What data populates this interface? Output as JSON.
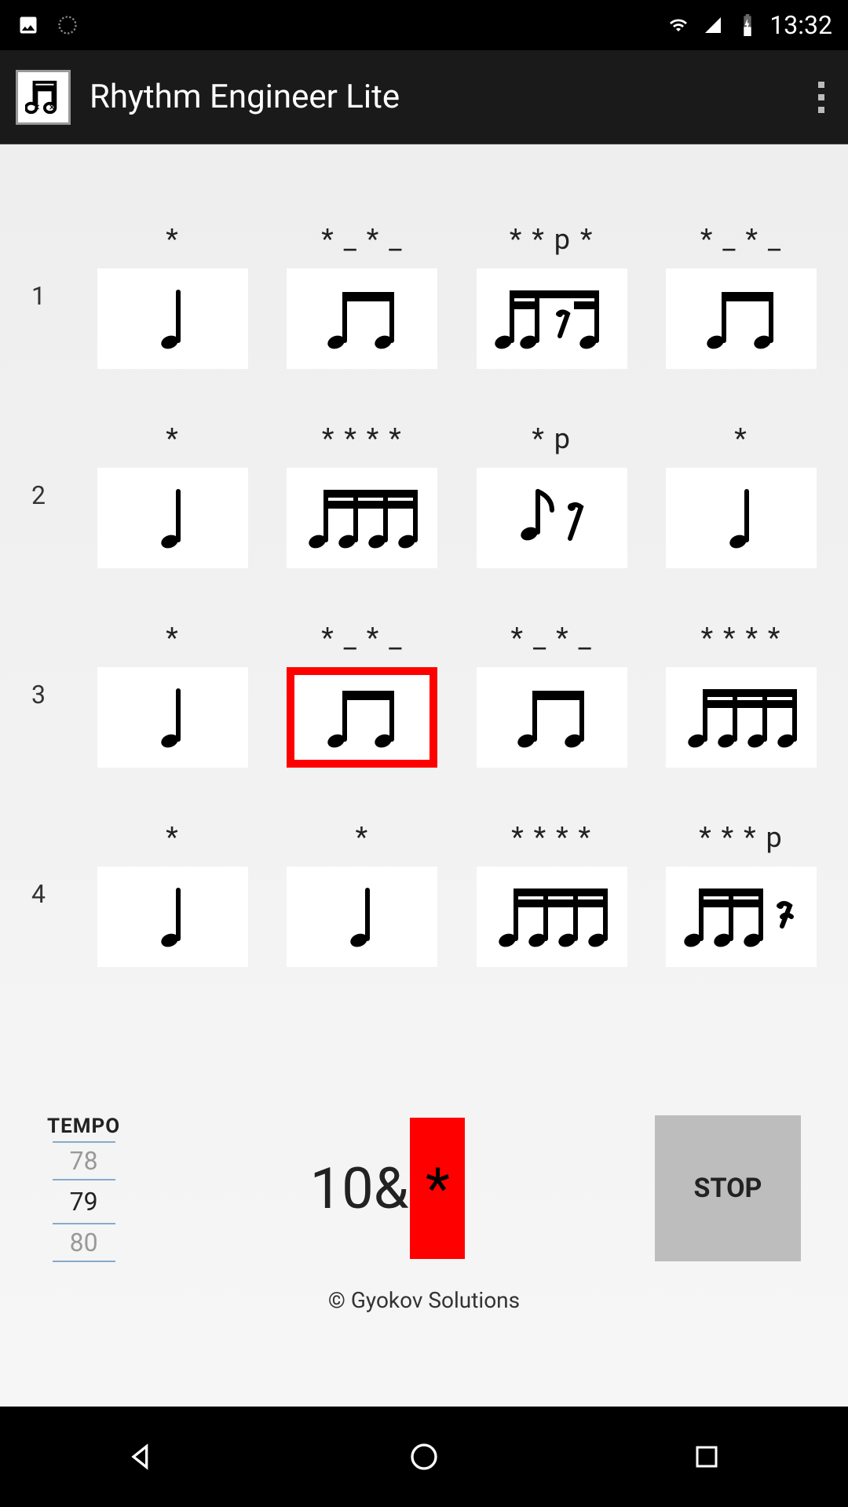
{
  "status": {
    "time": "13:32"
  },
  "appbar": {
    "title": "Rhythm Engineer Lite"
  },
  "grid": {
    "rows": [
      {
        "num": "1",
        "cells": [
          {
            "label": "*",
            "note": "quarter",
            "active": false
          },
          {
            "label": "* _ * _",
            "note": "two8",
            "active": false
          },
          {
            "label": "* * p *",
            "note": "sixteenth-rest",
            "active": false
          },
          {
            "label": "* _ * _",
            "note": "two8",
            "active": false
          }
        ]
      },
      {
        "num": "2",
        "cells": [
          {
            "label": "*",
            "note": "quarter",
            "active": false
          },
          {
            "label": "* * * *",
            "note": "four16",
            "active": false
          },
          {
            "label": "* p",
            "note": "eighth-rest",
            "active": false
          },
          {
            "label": "*",
            "note": "quarter",
            "active": false
          }
        ]
      },
      {
        "num": "3",
        "cells": [
          {
            "label": "*",
            "note": "quarter",
            "active": false
          },
          {
            "label": "* _ * _",
            "note": "two8",
            "active": true
          },
          {
            "label": "* _ * _",
            "note": "two8",
            "active": false
          },
          {
            "label": "* * * *",
            "note": "four16",
            "active": false
          }
        ]
      },
      {
        "num": "4",
        "cells": [
          {
            "label": "*",
            "note": "quarter",
            "active": false
          },
          {
            "label": "*",
            "note": "quarter",
            "active": false
          },
          {
            "label": "* * * *",
            "note": "four16",
            "active": false
          },
          {
            "label": "* * * p",
            "note": "three16-rest",
            "active": false
          }
        ]
      }
    ]
  },
  "controls": {
    "tempo_label": "TEMPO",
    "tempo_prev": "78",
    "tempo_current": "79",
    "tempo_next": "80",
    "beat_prefix": "10&",
    "beat_mark": "*",
    "stop_label": "STOP"
  },
  "footer": {
    "copyright": "© Gyokov Solutions"
  }
}
